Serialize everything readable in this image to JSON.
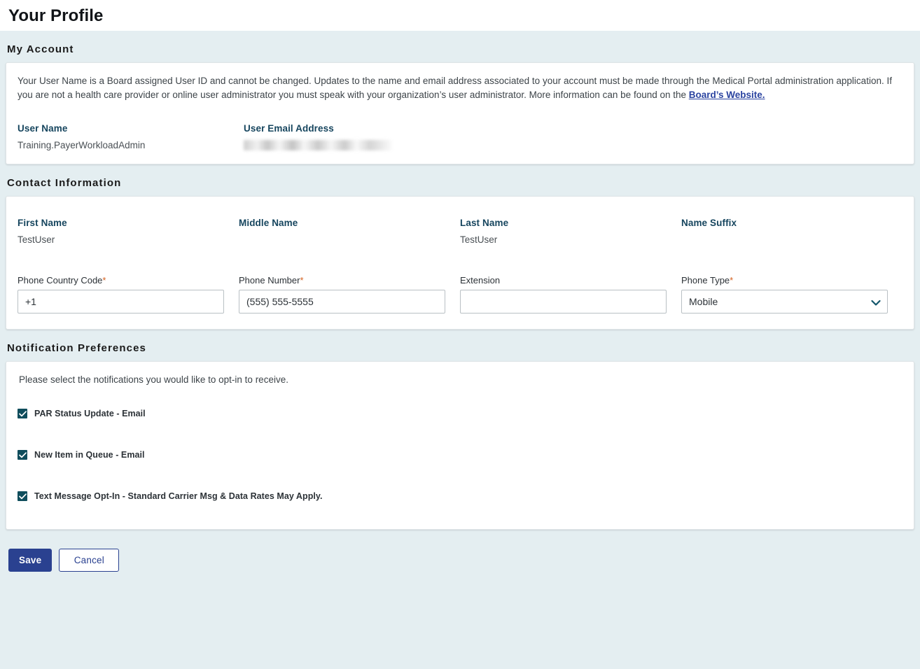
{
  "page": {
    "title": "Your Profile"
  },
  "colors": {
    "page_background": "#e4eef1",
    "accent_blue": "#2a4190",
    "label_teal": "#16455e",
    "checkbox_teal": "#0f4d5c",
    "required_asterisk": "#d4601f"
  },
  "my_account": {
    "heading": "My Account",
    "intro_before_link": "Your User Name is a Board assigned User ID and cannot be changed. Updates to the name and email address associated to your account must be made through the Medical Portal administration application. If you are not a health care provider or online user administrator you must speak with your organization’s user administrator. More information can be found on the ",
    "intro_link": "Board’s Website.",
    "user_name_label": "User Name",
    "user_name_value": "Training.PayerWorkloadAdmin",
    "user_email_label": "User Email Address",
    "user_email_value": ""
  },
  "contact_information": {
    "heading": "Contact Information",
    "first_name_label": "First Name",
    "first_name_value": "TestUser",
    "middle_name_label": "Middle Name",
    "middle_name_value": "",
    "last_name_label": "Last Name",
    "last_name_value": "TestUser",
    "name_suffix_label": "Name Suffix",
    "name_suffix_value": "",
    "phone_country_code_label": "Phone Country Code",
    "phone_country_code_required": "*",
    "phone_country_code_value": "+1",
    "phone_number_label": "Phone Number",
    "phone_number_required": "*",
    "phone_number_value": "(555) 555-5555",
    "extension_label": "Extension",
    "extension_value": "",
    "phone_type_label": "Phone Type",
    "phone_type_required": "*",
    "phone_type_value": "Mobile"
  },
  "notification_preferences": {
    "heading": "Notification Preferences",
    "intro": "Please select the notifications you would like to opt-in to receive.",
    "items": [
      {
        "label": "PAR Status Update - Email",
        "checked": true
      },
      {
        "label": "New Item in Queue - Email",
        "checked": true
      },
      {
        "label": "Text Message Opt-In - Standard Carrier Msg & Data Rates May Apply.",
        "checked": true
      }
    ]
  },
  "actions": {
    "save_label": "Save",
    "cancel_label": "Cancel"
  }
}
